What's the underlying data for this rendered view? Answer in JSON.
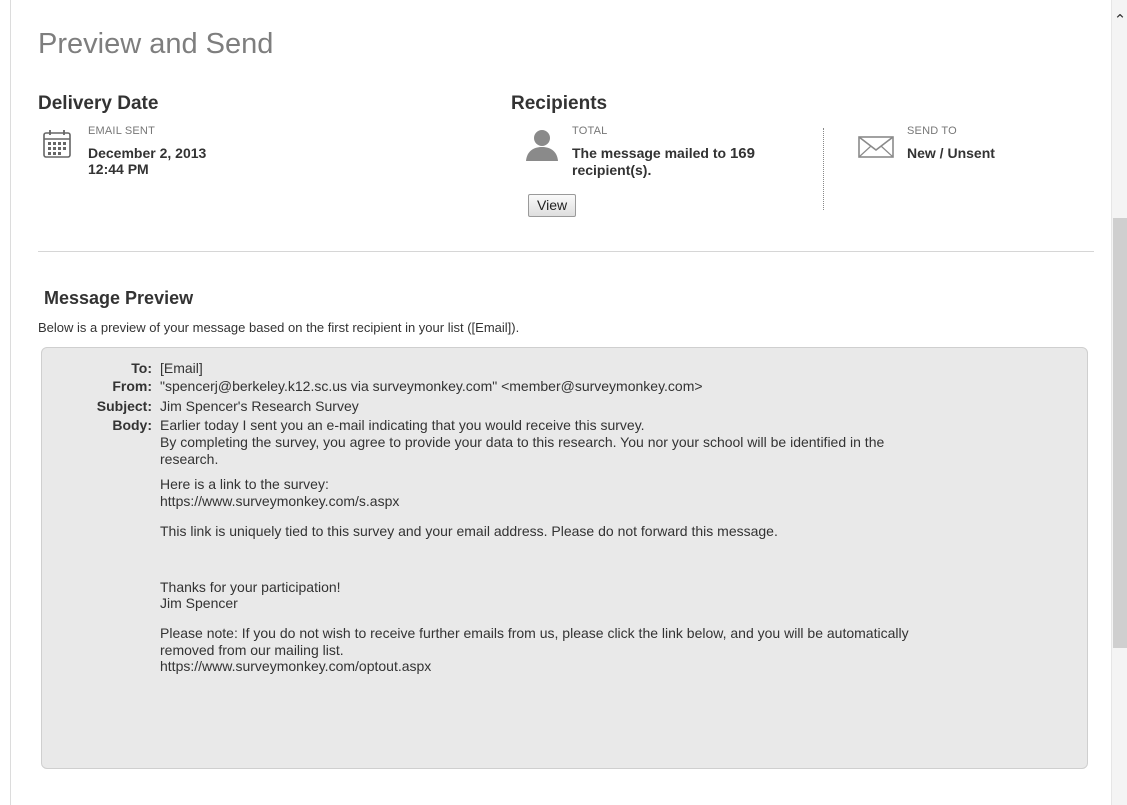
{
  "page_title": "Preview and Send",
  "delivery": {
    "heading": "Delivery Date",
    "caption": "EMAIL SENT",
    "date": "December 2, 2013",
    "time": "12:44 PM"
  },
  "recipients": {
    "heading": "Recipients",
    "total_caption": "TOTAL",
    "message_prefix": "The message mailed to",
    "count": "169",
    "message_suffix": "recipient(s).",
    "view_label": "View",
    "send_to_caption": "SEND TO",
    "send_to_value": "New / Unsent"
  },
  "preview": {
    "heading": "Message Preview",
    "description": "Below is a preview of your message based on the first recipient in your list ([Email]).",
    "to_label": "To:",
    "to_value": "[Email]",
    "from_label": "From:",
    "from_value": "\"spencerj@berkeley.k12.sc.us via surveymonkey.com\" <member@surveymonkey.com>",
    "subject_label": "Subject:",
    "subject_value": "Jim Spencer's Research Survey",
    "body_label": "Body:",
    "body_lines": [
      "Earlier today I sent you an e-mail indicating that you would receive this survey.",
      "By completing the survey, you agree to provide your data to this research.  You nor your school will be identified in the",
      "research.",
      "Here is a link to the survey:",
      "https://www.surveymonkey.com/s.aspx",
      "This link is uniquely tied to this survey and your email address. Please do not forward this message.",
      "Thanks for your participation!",
      "Jim Spencer",
      "Please note: If you do not wish to receive further emails from us, please click the link below, and you will be automatically",
      "removed from our mailing list.",
      "https://www.surveymonkey.com/optout.aspx"
    ]
  },
  "icons": {
    "calendar": "calendar-icon",
    "person": "person-icon",
    "envelope": "envelope-icon",
    "scroll_up": "chevron-up-icon"
  },
  "colors": {
    "title_gray": "#7e7e7e",
    "preview_bg": "#e9e9e9",
    "scroll_thumb": "#cfcfcf"
  }
}
